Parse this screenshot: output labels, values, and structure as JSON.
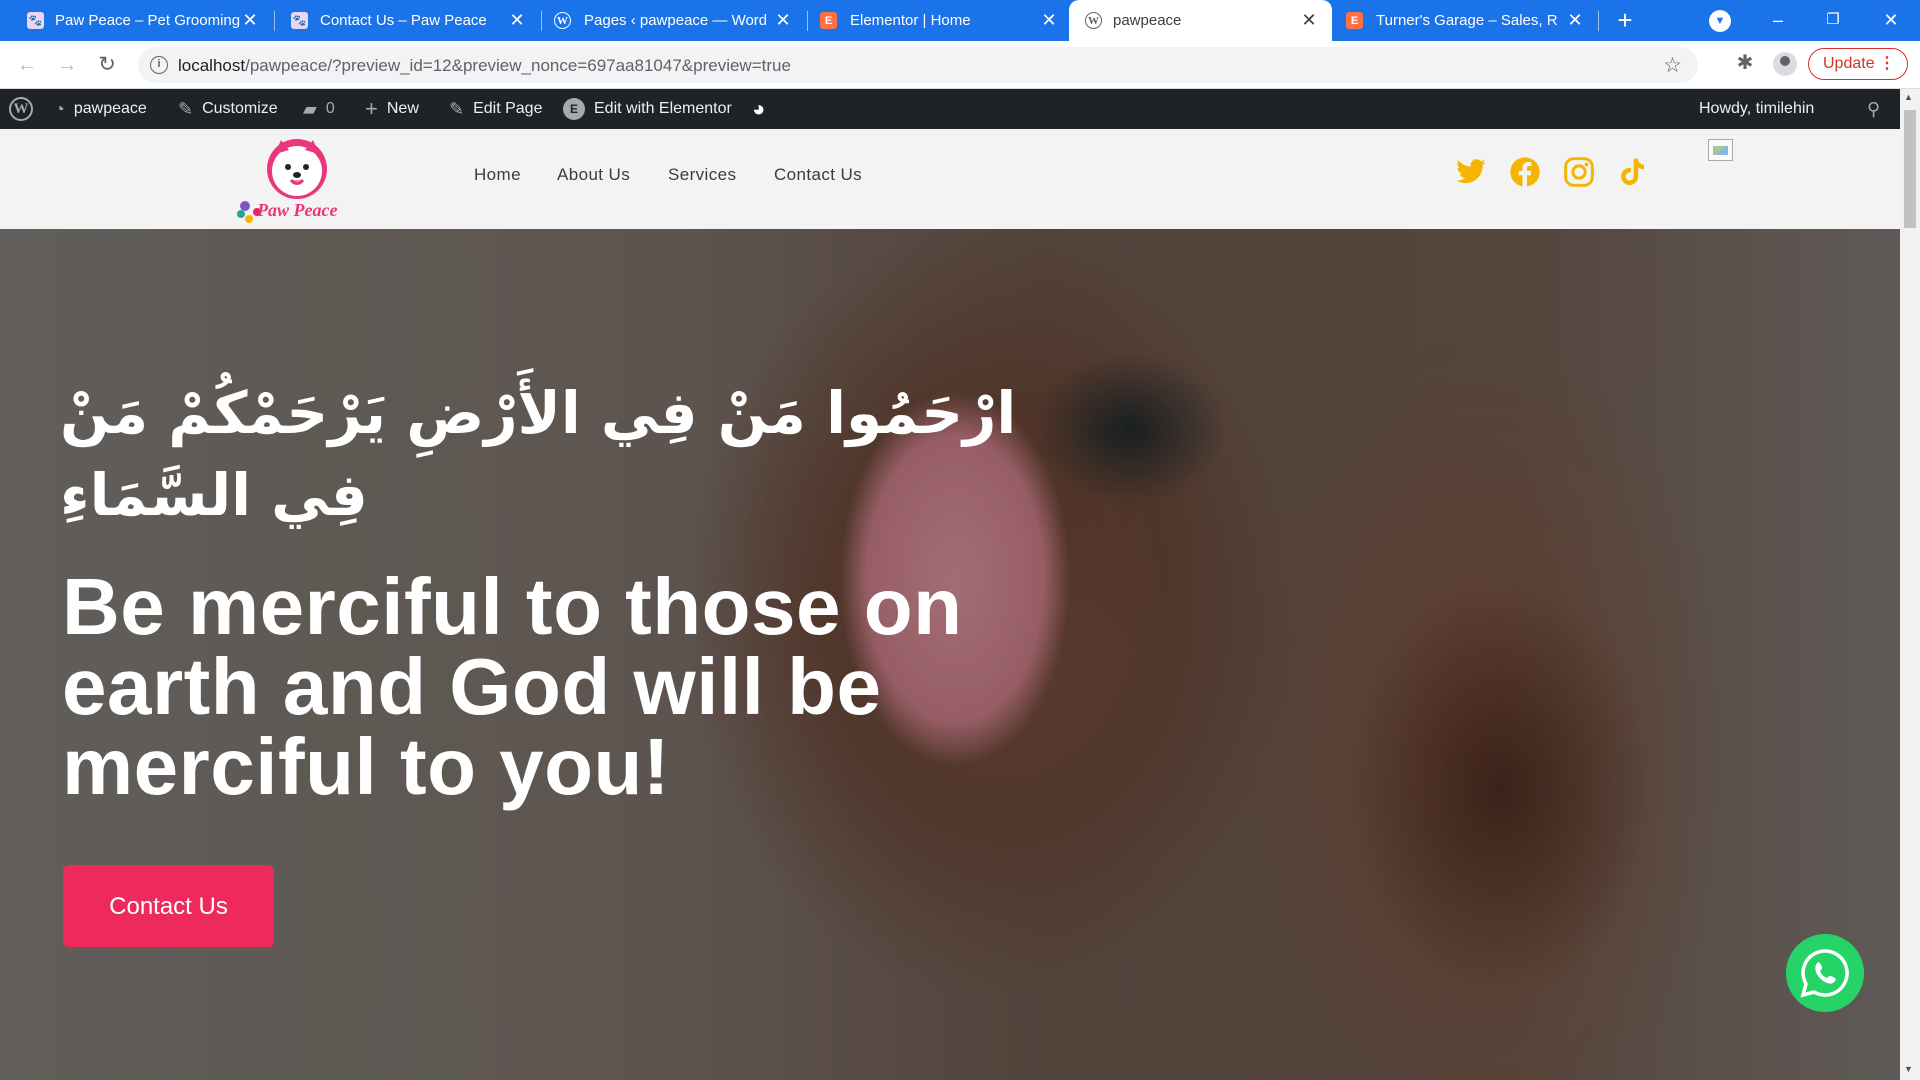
{
  "browser": {
    "tabs": [
      {
        "title": "Paw Peace – Pet Grooming,",
        "favicon": "pawpeace-favicon",
        "active": false
      },
      {
        "title": "Contact Us – Paw Peace",
        "favicon": "pawpeace-favicon",
        "active": false
      },
      {
        "title": "Pages ‹ pawpeace — WordP",
        "favicon": "wordpress-favicon",
        "active": false
      },
      {
        "title": "Elementor | Home",
        "favicon": "elementor-favicon",
        "active": false
      },
      {
        "title": "pawpeace",
        "favicon": "wordpress-favicon",
        "active": true
      },
      {
        "title": "Turner's Garage – Sales, Rep",
        "favicon": "elementor-favicon",
        "active": false
      }
    ],
    "url_host": "localhost",
    "url_path": "/pawpeace/?preview_id=12&preview_nonce=697aa81047&preview=true",
    "update_label": "Update"
  },
  "adminbar": {
    "site_name": "pawpeace",
    "customize": "Customize",
    "comments_count": "0",
    "new": "New",
    "edit_page": "Edit Page",
    "edit_elementor": "Edit with Elementor",
    "howdy": "Howdy, timilehin"
  },
  "header": {
    "logo_text": "Paw Peace",
    "nav": [
      "Home",
      "About Us",
      "Services",
      "Contact Us"
    ],
    "social_icons": [
      "twitter-icon",
      "facebook-icon",
      "instagram-icon",
      "tiktok-icon"
    ],
    "social_color": "#f5b400"
  },
  "hero": {
    "arabic_quote": "ارْحَمُوا مَنْ فِي الأَرْضِ يَرْحَمْكُمْ مَنْ فِي السَّمَاءِ",
    "headline": "Be merciful to those on earth and God will be merciful to you!",
    "cta_label": "Contact Us",
    "cta_color": "#ed2a5b"
  },
  "colors": {
    "tabstrip": "#1a73e8",
    "adminbar": "#1d2327",
    "whatsapp": "#25d366"
  }
}
